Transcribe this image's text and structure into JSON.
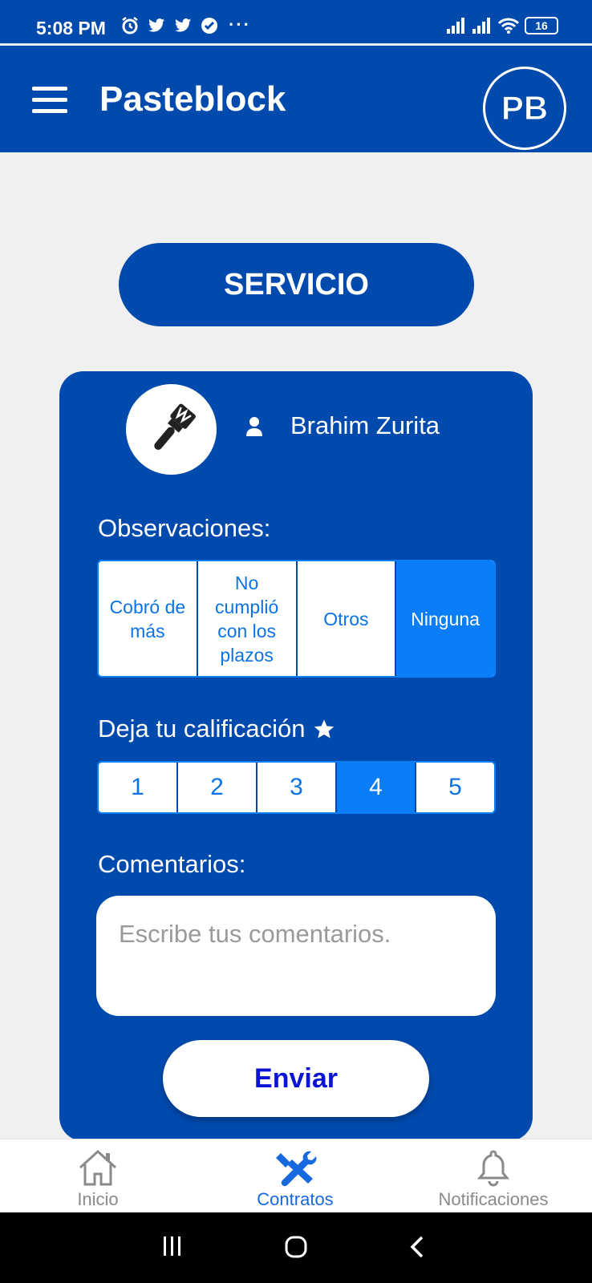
{
  "status_bar": {
    "time": "5:08 PM",
    "dots": "···",
    "battery": "16"
  },
  "app_bar": {
    "title": "Pasteblock",
    "logo_text": "PB",
    "menu_icon": "hamburger-menu-icon"
  },
  "service_button": {
    "label": "SERVICIO"
  },
  "card": {
    "user_name": "Brahim Zurita",
    "observations_label": "Observaciones:",
    "observations": [
      {
        "label": "Cobró de más",
        "selected": false
      },
      {
        "label": "No cumplió con los plazos",
        "selected": false
      },
      {
        "label": "Otros",
        "selected": false
      },
      {
        "label": "Ninguna",
        "selected": true
      }
    ],
    "rating_label": "Deja tu calificación",
    "ratings": [
      "1",
      "2",
      "3",
      "4",
      "5"
    ],
    "selected_rating": "4",
    "comments_label": "Comentarios:",
    "comments_placeholder": "Escribe tus comentarios.",
    "comments_value": "",
    "send_label": "Enviar"
  },
  "bottom_nav": [
    {
      "label": "Inicio",
      "icon": "home-icon",
      "active": false
    },
    {
      "label": "Contratos",
      "icon": "tools-icon",
      "active": true
    },
    {
      "label": "Notificaciones",
      "icon": "bell-icon",
      "active": false
    }
  ],
  "colors": {
    "primary": "#0049ad",
    "accent": "#0b7ef7",
    "background": "#f0f0f0",
    "send_text": "#0b14d6",
    "nav_active": "#1769e0"
  }
}
